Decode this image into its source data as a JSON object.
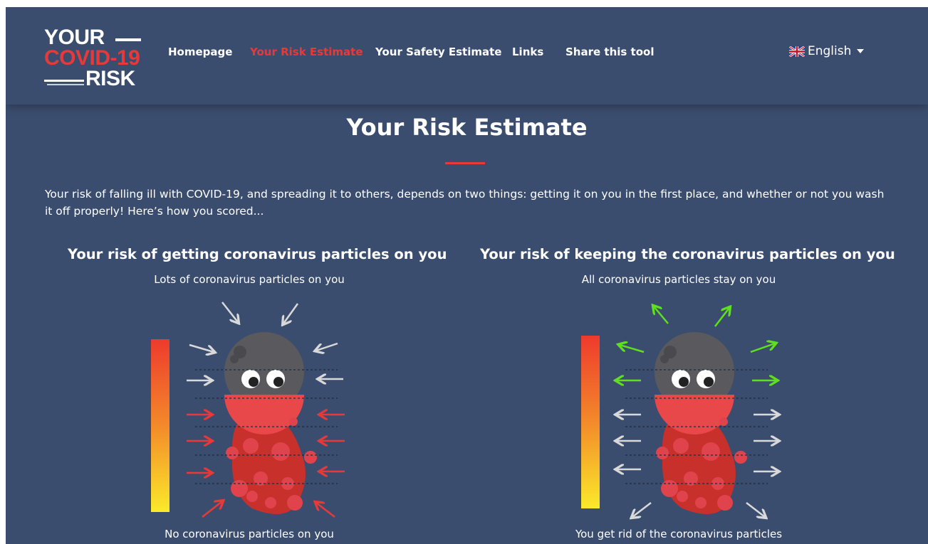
{
  "logo": {
    "line1": "YOUR",
    "line2": "COVID-19",
    "line3": "RISK"
  },
  "nav": {
    "items": [
      {
        "label": "Homepage",
        "active": false
      },
      {
        "label": "Your Risk Estimate",
        "active": true
      },
      {
        "label": "Your Safety Estimate",
        "active": false
      },
      {
        "label": "Links",
        "active": false
      },
      {
        "label": "Share this tool",
        "active": false
      }
    ],
    "language": "English"
  },
  "page": {
    "title": "Your Risk Estimate",
    "intro": "Your risk of falling ill with COVID-19, and spreading it to others, depends on two things: getting it on you in the first place, and whether or not you wash it off properly! Here’s how you scored..."
  },
  "panels": [
    {
      "title": "Your risk of getting coronavirus particles on you",
      "top_label": "Lots of coronavirus particles on you",
      "bottom_label": "No coronavirus particles on you"
    },
    {
      "title": "Your risk of keeping the coronavirus particles on you",
      "top_label": "All coronavirus particles stay on you",
      "bottom_label": "You get rid of the coronavirus particles"
    }
  ],
  "colors": {
    "background": "#3b4d6e",
    "accent_red": "#e8393a",
    "arrow_grey": "#d9d9d9",
    "arrow_green": "#5ee01f",
    "body_red": "#c8302c",
    "head_grey": "#5a5a5e"
  }
}
